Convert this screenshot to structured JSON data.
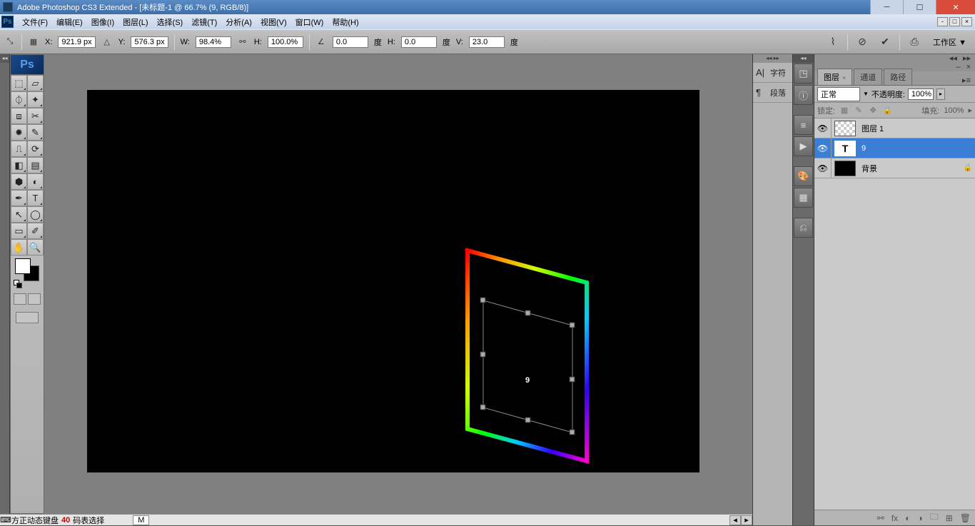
{
  "title": "Adobe Photoshop CS3 Extended - [未标题-1 @ 66.7% (9, RGB/8)]",
  "menubar": [
    "文件(F)",
    "编辑(E)",
    "图像(I)",
    "图层(L)",
    "选择(S)",
    "滤镜(T)",
    "分析(A)",
    "视图(V)",
    "窗口(W)",
    "帮助(H)"
  ],
  "options": {
    "x_label": "X:",
    "x": "921.9 px",
    "y_label": "Y:",
    "y": "576.3 px",
    "w_label": "W:",
    "w": "98.4%",
    "h_label": "H:",
    "h": "100.0%",
    "a_label": "",
    "a": "0.0",
    "a_unit": "度",
    "hs_label": "H:",
    "hs": "0.0",
    "hs_unit": "度",
    "v_label": "V:",
    "v": "23.0",
    "v_unit": "度",
    "workspace_label": "工作区 ▼"
  },
  "text_panel": {
    "char": "字符",
    "para": "段落"
  },
  "layers_panel": {
    "tabs": [
      "图层",
      "通道",
      "路径"
    ],
    "blend": "正常",
    "opacity_label": "不透明度:",
    "opacity": "100%",
    "lock_label": "锁定:",
    "fill_label": "填充:",
    "fill": "100%",
    "layers": [
      {
        "name": "图层 1",
        "type": "checker"
      },
      {
        "name": "9",
        "type": "text",
        "selected": true
      },
      {
        "name": "背景",
        "type": "black",
        "locked": true
      }
    ]
  },
  "statusbar": {
    "ime": "方正动态键盘",
    "code": "40",
    "sel": "码表选择",
    "m": "M"
  },
  "canvas_content": {
    "digit": "9"
  }
}
